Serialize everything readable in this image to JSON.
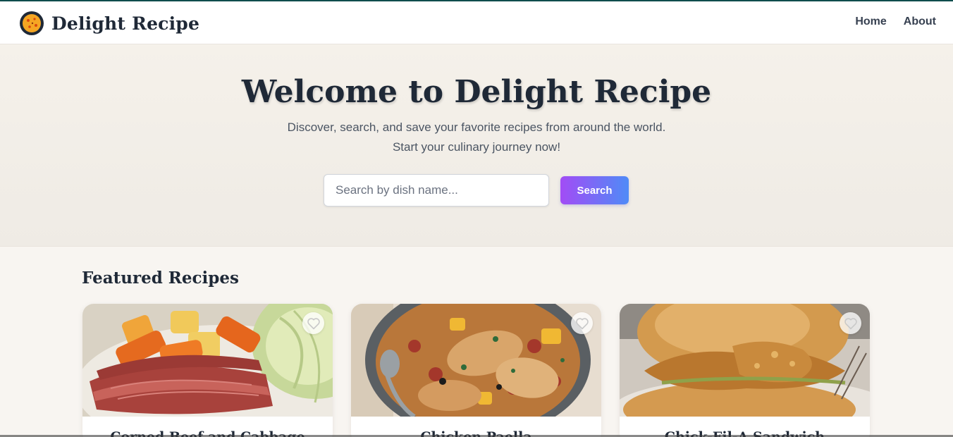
{
  "header": {
    "brand": "Delight Recipe",
    "nav": [
      {
        "label": "Home"
      },
      {
        "label": "About"
      }
    ]
  },
  "hero": {
    "title": "Welcome to Delight Recipe",
    "subtitle_line1": "Discover, search, and save your favorite recipes from around the world.",
    "subtitle_line2": "Start your culinary journey now!",
    "search": {
      "placeholder": "Search by dish name...",
      "value": "",
      "button_label": "Search"
    }
  },
  "featured": {
    "title": "Featured Recipes",
    "recipes": [
      {
        "title": "Corned Beef and Cabbage",
        "icon": "heart-outline-icon"
      },
      {
        "title": "Chicken Paella",
        "icon": "heart-outline-icon"
      },
      {
        "title": "Chick-Fil-A Sandwich",
        "icon": "heart-outline-icon"
      }
    ]
  },
  "colors": {
    "accent_gradient_start": "#a24cf5",
    "accent_gradient_end": "#4f8bf7",
    "text_dark": "#1f2937",
    "hero_bg": "#f5f1ea"
  }
}
